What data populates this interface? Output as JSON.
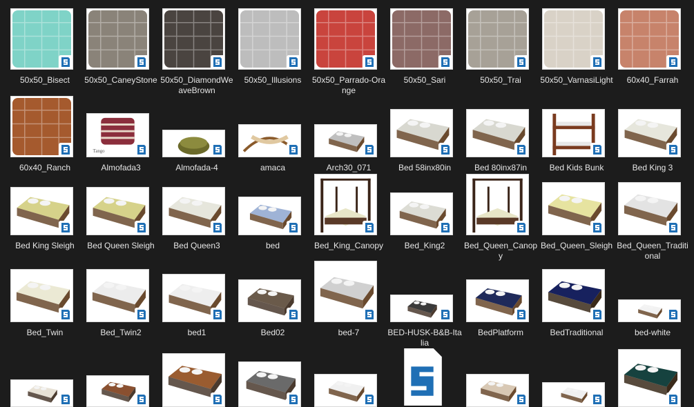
{
  "app": {
    "view": "large-icons",
    "colors": {
      "background": "#1c1c1c",
      "text": "#e6e6e6",
      "sketchup_blue": "#1f6fb5"
    }
  },
  "rows": [
    [
      {
        "name": "50x50_Bisect",
        "kind": "pillow",
        "color": "#7fd3c7",
        "h": 89
      },
      {
        "name": "50x50_CaneyStone",
        "kind": "pillow",
        "color": "#8a8379",
        "h": 89
      },
      {
        "name": "50x50_DiamondWeaveBrown",
        "kind": "pillow",
        "color": "#4a4440",
        "h": 89
      },
      {
        "name": "50x50_Illusions",
        "kind": "pillow",
        "color": "#bdbdbd",
        "h": 89
      },
      {
        "name": "50x50_Parrado-Orange",
        "kind": "pillow",
        "color": "#c9443d",
        "h": 89
      },
      {
        "name": "50x50_Sari",
        "kind": "pillow",
        "color": "#8c6a66",
        "h": 89
      },
      {
        "name": "50x50_Trai",
        "kind": "pillow",
        "color": "#a7a197",
        "h": 89
      },
      {
        "name": "50x50_VarnasiLight",
        "kind": "pillow",
        "color": "#d9d2c7",
        "h": 89
      },
      {
        "name": "60x40_Farrah",
        "kind": "pillow",
        "color": "#c7836b",
        "h": 89
      }
    ],
    [
      {
        "name": "60x40_Ranch",
        "kind": "pillow",
        "color": "#a55a2e",
        "h": 89
      },
      {
        "name": "Almofada3",
        "kind": "cushion",
        "color": "#8b2e3c",
        "h": 64
      },
      {
        "name": "Almofada-4",
        "kind": "pouf",
        "color": "#6b6a2a",
        "h": 40
      },
      {
        "name": "amaca",
        "kind": "hammock",
        "color": "#8a5a2b",
        "h": 48
      },
      {
        "name": "Arch30_071",
        "kind": "bed-wire",
        "color": "#bfbfbf",
        "h": 48
      },
      {
        "name": "Bed 58inx80in",
        "kind": "bed",
        "color": "#d8d8d0",
        "h": 70
      },
      {
        "name": "Bed 80inx87in",
        "kind": "bed",
        "color": "#d8d8d0",
        "h": 70
      },
      {
        "name": "Bed Kids Bunk",
        "kind": "bunk",
        "color": "#7a3b1f",
        "h": 70
      },
      {
        "name": "Bed King 3",
        "kind": "bed",
        "color": "#e6e6dc",
        "h": 70
      }
    ],
    [
      {
        "name": "Bed King Sleigh",
        "kind": "bed",
        "color": "#d6d28a",
        "h": 70
      },
      {
        "name": "Bed Queen Sleigh",
        "kind": "bed",
        "color": "#d6d28a",
        "h": 70
      },
      {
        "name": "Bed Queen3",
        "kind": "bed",
        "color": "#e6e6dc",
        "h": 70
      },
      {
        "name": "bed",
        "kind": "bed-quilt",
        "color": "#9fb3d6",
        "h": 56
      },
      {
        "name": "Bed_King_Canopy",
        "kind": "canopy",
        "color": "#e8e6c8",
        "h": 89
      },
      {
        "name": "Bed_King2",
        "kind": "bed",
        "color": "#dcdcd4",
        "h": 62
      },
      {
        "name": "Bed_Queen_Canopy",
        "kind": "canopy",
        "color": "#e8e6c8",
        "h": 89
      },
      {
        "name": "Bed_Queen_Sleigh",
        "kind": "bed",
        "color": "#e6e3a0",
        "h": 77
      },
      {
        "name": "Bed_Queen_Traditional",
        "kind": "bed",
        "color": "#e3e3e3",
        "h": 77
      }
    ],
    [
      {
        "name": "Bed_Twin",
        "kind": "bed-twin",
        "color": "#ebe9d4",
        "h": 77
      },
      {
        "name": "Bed_Twin2",
        "kind": "bed",
        "color": "#ececec",
        "h": 77
      },
      {
        "name": "bed1",
        "kind": "bed",
        "color": "#eeeeee",
        "h": 70
      },
      {
        "name": "Bed02",
        "kind": "bed-modern",
        "color": "#6a5a4a",
        "h": 62
      },
      {
        "name": "bed-7",
        "kind": "bed-linen",
        "color": "#d0d0d0",
        "h": 89
      },
      {
        "name": "BED-HUSK-B&B-Italia",
        "kind": "bed-modern",
        "color": "#3a3a3a",
        "h": 40
      },
      {
        "name": "BedPlatform",
        "kind": "bed-small",
        "color": "#1f2a5a",
        "h": 62
      },
      {
        "name": "BedTraditional",
        "kind": "bed-dark",
        "color": "#17215e",
        "h": 77
      },
      {
        "name": "bed-white",
        "kind": "bed-white",
        "color": "#f2f2f2",
        "h": 33
      }
    ],
    [
      {
        "name": "",
        "kind": "bed-modern",
        "color": "#e8e2d6",
        "h": 40
      },
      {
        "name": "",
        "kind": "bed-modern",
        "color": "#8a5030",
        "h": 46
      },
      {
        "name": "",
        "kind": "bed-modern",
        "color": "#9a5c30",
        "h": 78
      },
      {
        "name": "",
        "kind": "bed-modern",
        "color": "#6a6a6a",
        "h": 66
      },
      {
        "name": "",
        "kind": "bed-white",
        "color": "#f0f0f0",
        "h": 48
      },
      {
        "name": "",
        "kind": "generic-file",
        "color": "#1f6fb5",
        "h": 89
      },
      {
        "name": "",
        "kind": "bed-linen",
        "color": "#d8c8b4",
        "h": 48
      },
      {
        "name": "",
        "kind": "bed-white",
        "color": "#f0f0f0",
        "h": 36
      },
      {
        "name": "",
        "kind": "bed-dark",
        "color": "#16423f",
        "h": 84
      }
    ]
  ]
}
